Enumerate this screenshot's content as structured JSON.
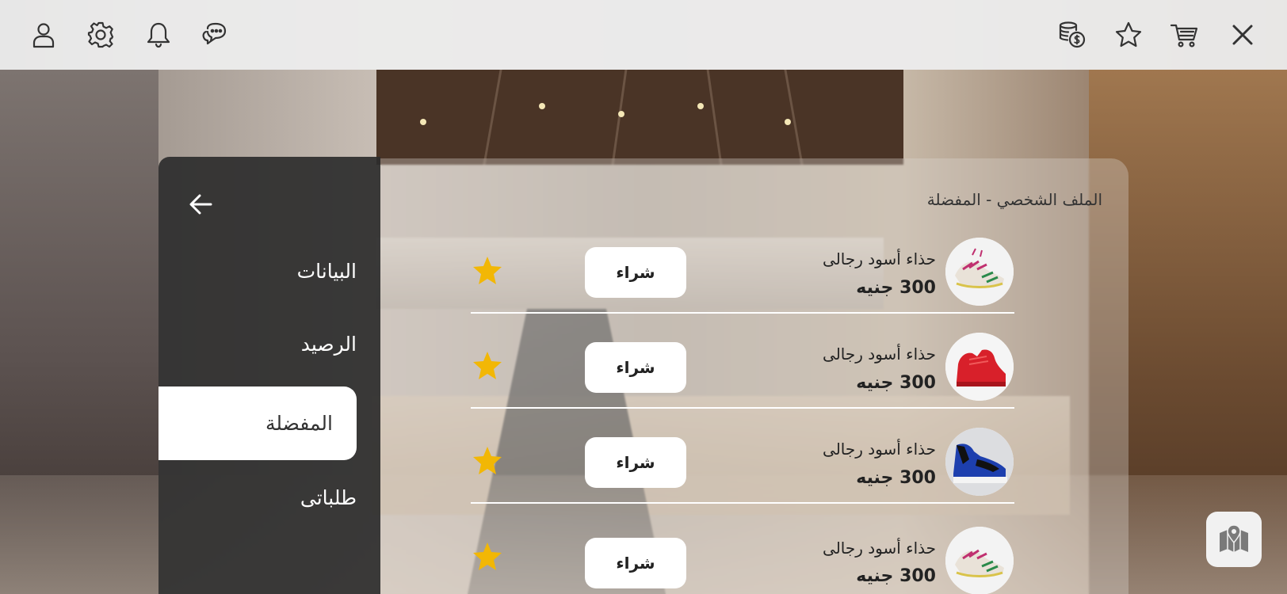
{
  "topbar": {
    "right_icons": [
      "close-icon",
      "cart-icon",
      "star-icon",
      "coins-icon"
    ],
    "left_icons": [
      "chat-icon",
      "bell-icon",
      "gear-icon",
      "user-icon"
    ]
  },
  "sidebar": {
    "items": [
      {
        "label": "البيانات"
      },
      {
        "label": "الرصيد"
      },
      {
        "label": "المفضلة"
      },
      {
        "label": "طلباتى"
      }
    ],
    "active_index": 2
  },
  "main": {
    "breadcrumb": "الملف الشخصي - المفضلة",
    "favorites": [
      {
        "name": "حذاء أسود رجالى",
        "price": "300 جنيه",
        "buy_label": "شراء",
        "image": "sneaker-colorful"
      },
      {
        "name": "حذاء أسود رجالى",
        "price": "300 جنيه",
        "buy_label": "شراء",
        "image": "sneaker-red"
      },
      {
        "name": "حذاء أسود رجالى",
        "price": "300 جنيه",
        "buy_label": "شراء",
        "image": "sneaker-blue"
      },
      {
        "name": "حذاء أسود رجالى",
        "price": "300 جنيه",
        "buy_label": "شراء",
        "image": "sneaker-colorful"
      }
    ]
  },
  "colors": {
    "star": "#f2b705",
    "sidebar_bg": "#2d2d2d",
    "topbar_bg": "#ececec"
  }
}
